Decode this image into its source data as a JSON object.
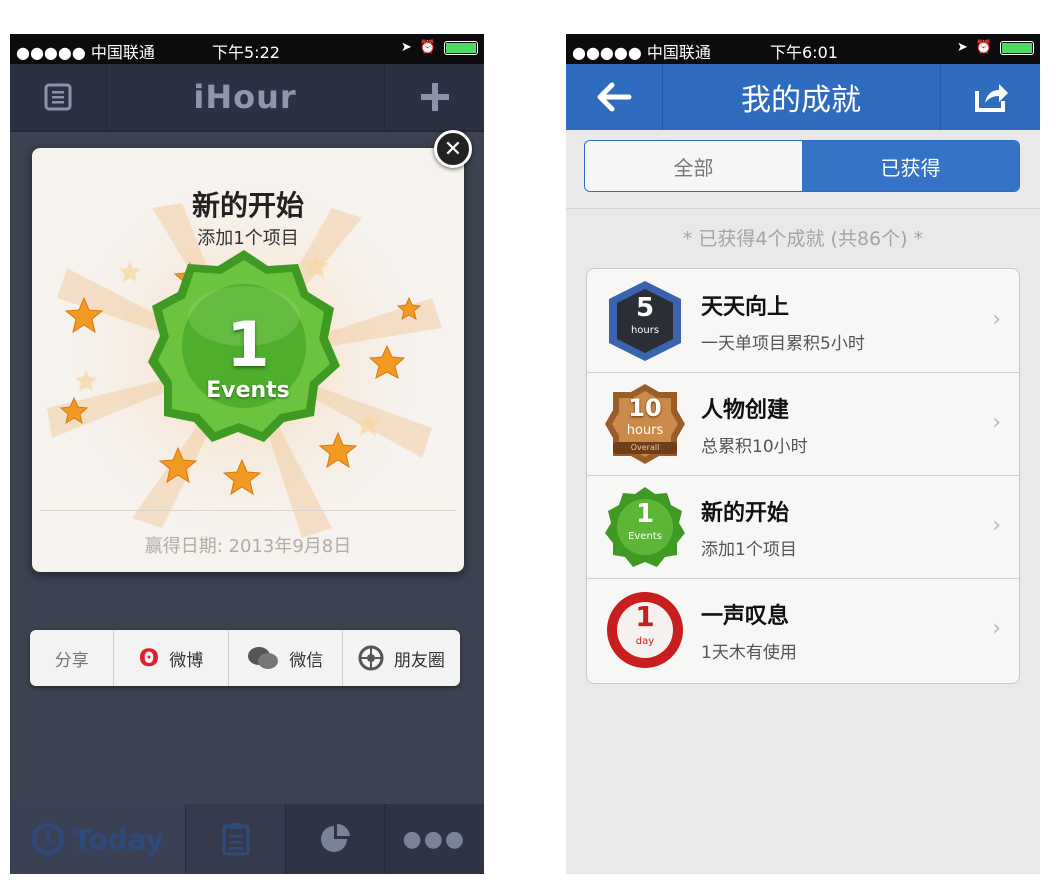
{
  "left": {
    "status": {
      "carrier": "●●●●● 中国联通",
      "time": "下午5:22"
    },
    "nav": {
      "title": "iHour",
      "menu_icon": "list-icon",
      "add_icon": "plus-icon"
    },
    "achievement": {
      "title": "新的开始",
      "subtitle": "添加1个项目",
      "badge_number": "1",
      "badge_label": "Events",
      "date": "赢得日期: 2013年9月8日"
    },
    "share": {
      "label": "分享",
      "weibo": "微博",
      "wechat": "微信",
      "moments": "朋友圈"
    },
    "tabs": {
      "today": "Today"
    }
  },
  "right": {
    "status": {
      "carrier": "●●●●● 中国联通",
      "time": "下午6:01"
    },
    "nav": {
      "title": "我的成就"
    },
    "segment": {
      "all": "全部",
      "earned": "已获得"
    },
    "summary": "* 已获得4个成就 (共86个) *",
    "achievements": [
      {
        "title": "天天向上",
        "desc": "一天单项目累积5小时",
        "badge_num": "5",
        "badge_unit": "hours"
      },
      {
        "title": "人物创建",
        "desc": "总累积10小时",
        "badge_num": "10",
        "badge_unit": "hours",
        "badge_extra": "Overall"
      },
      {
        "title": "新的开始",
        "desc": "添加1个项目",
        "badge_num": "1",
        "badge_unit": "Events"
      },
      {
        "title": "一声叹息",
        "desc": "1天木有使用",
        "badge_num": "1",
        "badge_unit": "day"
      }
    ]
  },
  "colors": {
    "nav_blue": "#2f6cc0",
    "dark_bg": "#3d4250",
    "badge_green": "#5bb535"
  }
}
